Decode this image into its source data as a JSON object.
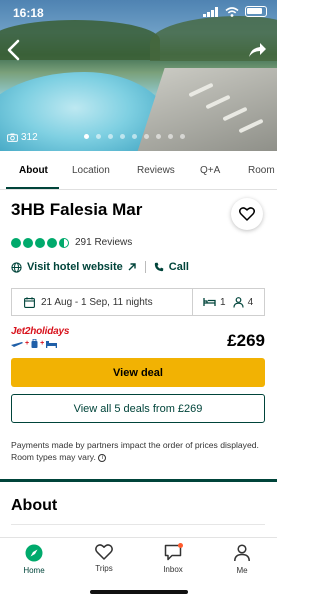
{
  "status_bar": {
    "time": "16:18"
  },
  "hero": {
    "photo_count": "312",
    "dot_count": 9,
    "active_dot": 0
  },
  "tabs": [
    {
      "label": "About",
      "active": true
    },
    {
      "label": "Location",
      "active": false
    },
    {
      "label": "Reviews",
      "active": false
    },
    {
      "label": "Q+A",
      "active": false
    },
    {
      "label": "Room T",
      "active": false
    }
  ],
  "hotel": {
    "name": "3HB Falesia Mar",
    "rating": 4.5,
    "review_count": "291 Reviews",
    "website_link": "Visit hotel website",
    "call_link": "Call"
  },
  "booking": {
    "dates": "21 Aug - 1 Sep, 11 nights",
    "rooms": "1",
    "guests": "4"
  },
  "deal": {
    "provider": "Jet2holidays",
    "price": "£269",
    "view_deal_label": "View deal",
    "view_all_label": "View all 5 deals from £269",
    "disclaimer": "Payments made by partners impact the order of prices displayed. Room types may vary."
  },
  "section": {
    "about_heading": "About"
  },
  "bottom_nav": [
    {
      "label": "Home",
      "icon": "compass-icon",
      "active": true
    },
    {
      "label": "Trips",
      "icon": "heart-icon",
      "active": false
    },
    {
      "label": "Inbox",
      "icon": "chat-bubble-icon",
      "active": false,
      "badge": true
    },
    {
      "label": "Me",
      "icon": "person-icon",
      "active": false
    }
  ],
  "colors": {
    "brand_green": "#00443a",
    "rating_green": "#00aa6c",
    "deal_yellow": "#f2b203",
    "notification": "#ff5a2c"
  }
}
